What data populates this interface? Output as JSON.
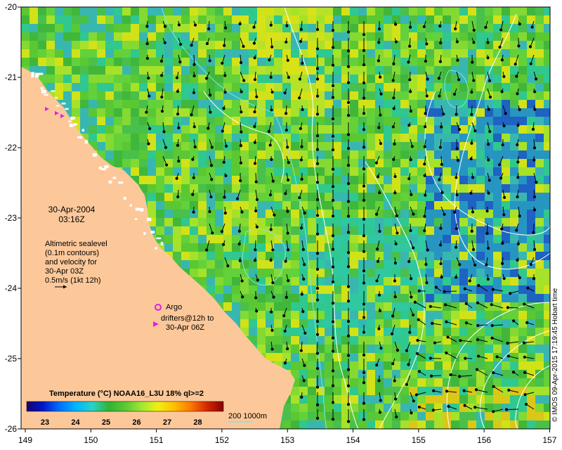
{
  "annotations": {
    "date": "30-Apr-2004",
    "time": "03:16Z",
    "altimetry_lines": [
      "Altimetric sealevel",
      "(0.1m contours)",
      "and velocity for",
      "30-Apr 03Z",
      "0.5m/s (1kt 12h)"
    ],
    "argo": "Argo",
    "drifters_lines": [
      "drifters@12h to",
      "30-Apr 06Z"
    ],
    "credit": "© IMOS 09-Apr-2015 17:19:45 Hobart time"
  },
  "colorbar": {
    "title": "Temperature (°C) NOAA16_L3U 18% ql>=2",
    "ticks": [
      "23",
      "24",
      "25",
      "26",
      "27",
      "28"
    ],
    "colors": [
      "#1a006e",
      "#0018c8",
      "#0070ff",
      "#00b4ff",
      "#28d2c8",
      "#32b432",
      "#5ac832",
      "#a0e632",
      "#f0f014",
      "#ffbe00",
      "#ff7800",
      "#d22800",
      "#8c0000"
    ]
  },
  "depth_legend": {
    "label": "200  1000m",
    "color": "#7fe6e6"
  },
  "axes": {
    "x_ticks": [
      "149",
      "150",
      "151",
      "152",
      "153",
      "154",
      "155",
      "156",
      "157"
    ],
    "y_ticks": [
      "-20",
      "-21",
      "-22",
      "-23",
      "-24",
      "-25",
      "-26"
    ],
    "land_color": "#fcc89a",
    "argo_color": "#e020e0",
    "drifter_color": "#e020e0"
  }
}
